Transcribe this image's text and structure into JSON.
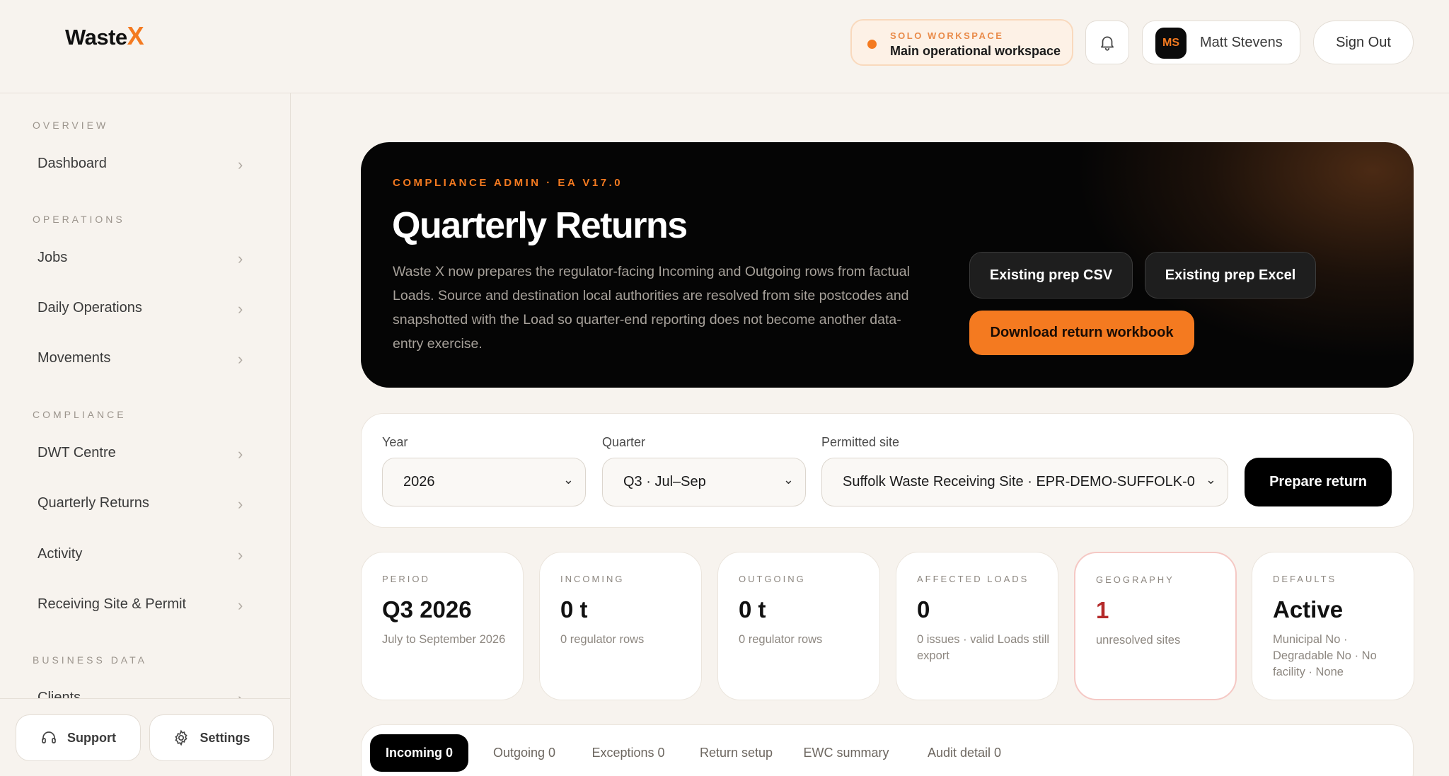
{
  "brand": {
    "logo_text": "Waste",
    "logo_x": "X"
  },
  "workspace": {
    "label": "SOLO WORKSPACE",
    "name": "Main operational workspace"
  },
  "user": {
    "initials": "MS",
    "name": "Matt Stevens"
  },
  "header": {
    "signout_label": "Sign Out"
  },
  "sidebar": {
    "sections": {
      "overview": "OVERVIEW",
      "operations": "OPERATIONS",
      "compliance": "COMPLIANCE",
      "business_data": "BUSINESS DATA"
    },
    "items": {
      "dashboard": "Dashboard",
      "jobs": "Jobs",
      "daily_operations": "Daily Operations",
      "movements": "Movements",
      "dwt_centre": "DWT Centre",
      "quarterly_returns": "Quarterly Returns",
      "activity": "Activity",
      "receiving_site": "Receiving Site & Permit",
      "clients": "Clients"
    },
    "support_label": "Support",
    "settings_label": "Settings"
  },
  "hero": {
    "eyebrow": "COMPLIANCE ADMIN · EA V17.0",
    "title": "Quarterly Returns",
    "description": "Waste X now prepares the regulator-facing Incoming and Outgoing rows from factual Loads. Source and destination local authorities are resolved from site postcodes and snapshotted with the Load so quarter-end reporting does not become another data-entry exercise.",
    "csv_button": "Existing prep CSV",
    "excel_button": "Existing prep Excel",
    "download_button": "Download return workbook"
  },
  "filters": {
    "year_label": "Year",
    "year_value": "2026",
    "quarter_label": "Quarter",
    "quarter_value": "Q3 · Jul–Sep",
    "site_label": "Permitted site",
    "site_value": "Suffolk Waste Receiving Site · EPR-DEMO-SUFFOLK-0",
    "prepare_button": "Prepare return"
  },
  "stats": {
    "period": {
      "label": "PERIOD",
      "value": "Q3 2026",
      "sub": "July to September 2026"
    },
    "incoming": {
      "label": "INCOMING",
      "value": "0 t",
      "sub": "0 regulator rows"
    },
    "outgoing": {
      "label": "OUTGOING",
      "value": "0 t",
      "sub": "0 regulator rows"
    },
    "affected": {
      "label": "AFFECTED LOADS",
      "value": "0",
      "sub": "0 issues · valid Loads still export"
    },
    "geography": {
      "label": "GEOGRAPHY",
      "value": "1",
      "sub": "unresolved sites"
    },
    "defaults": {
      "label": "DEFAULTS",
      "value": "Active",
      "sub": "Municipal No · Degradable No · No facility · None"
    }
  },
  "tabs": {
    "incoming": "Incoming 0",
    "outgoing": "Outgoing 0",
    "exceptions": "Exceptions 0",
    "return_setup": "Return setup",
    "ewc_summary": "EWC summary",
    "audit_detail": "Audit detail 0"
  },
  "colors": {
    "accent": "#f47a20",
    "warning": "#b52a2a",
    "background": "#f7f3ee"
  }
}
